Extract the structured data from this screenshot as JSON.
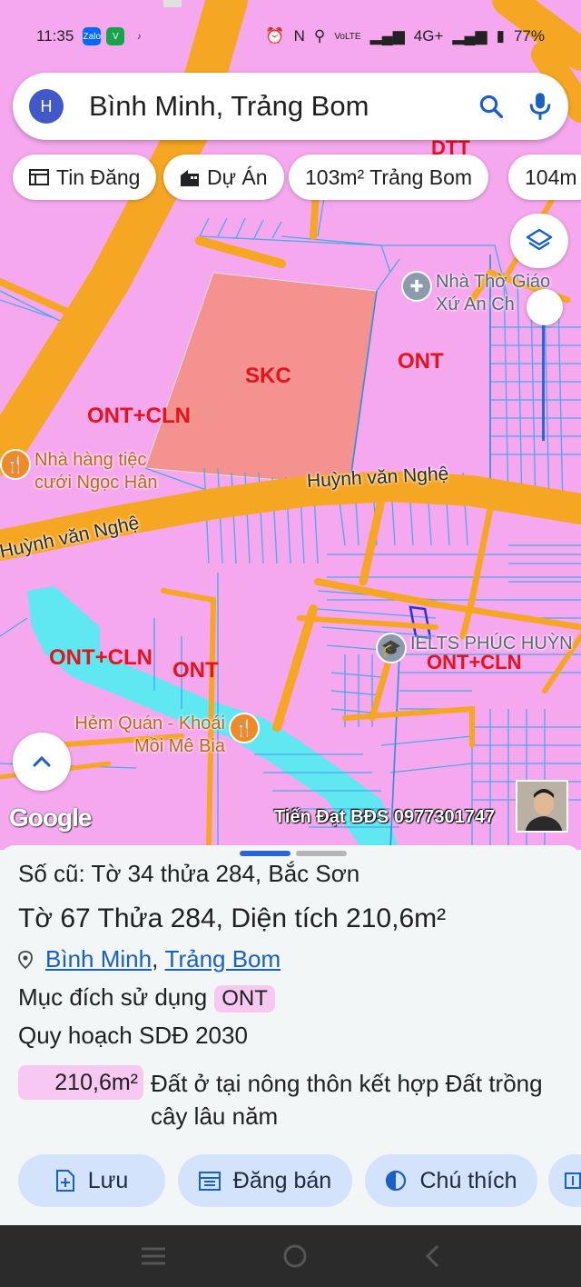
{
  "status_bar": {
    "time": "11:35",
    "apps": [
      "Zalo",
      "V",
      "TikTok"
    ],
    "network": "4G+",
    "battery": "77%",
    "volte": "VoLTE"
  },
  "search": {
    "avatar_letter": "H",
    "query": "Bình Minh, Trảng Bom"
  },
  "chips": [
    {
      "label": "Tin Đăng",
      "icon": "listing-icon"
    },
    {
      "label": "Dự Án",
      "icon": "building-icon"
    },
    {
      "label": "103m² Trảng Bom"
    },
    {
      "label": "104m"
    }
  ],
  "map": {
    "zone_labels": {
      "skc": "SKC",
      "ont_top": "ONT",
      "ont_cln_left": "ONT+CLN",
      "ont_cln_bottom_left": "ONT+CLN",
      "ont_bottom": "ONT",
      "ont_cln_right": "ONT+CLN",
      "dtt": "DTT"
    },
    "road_names": {
      "road_a": "Huỳnh văn Nghệ",
      "road_b": "Huỳnh văn Nghệ"
    },
    "pois": {
      "church": "Nhà Thờ Giáo Xứ An Ch",
      "restaurant": "Nhà hàng tiệc cưới Ngọc Hân",
      "ielts": "IELTS PHÚC HUỲN",
      "eatery": "Hẻm Quán - Khoái Mồi Mê Bia"
    },
    "google_logo": "Google",
    "watermark": "Tiến Đạt BĐS 0977301747"
  },
  "sheet": {
    "old_id": "Số cũ: Tờ 34 thửa 284, Bắc Sơn",
    "parcel": "Tờ 67 Thửa 284, Diện tích 210,6m²",
    "location": {
      "ward": "Bình Minh",
      "separator": ", ",
      "district": "Trảng Bom"
    },
    "purpose_label": "Mục đích sử dụng",
    "purpose_code": "ONT",
    "plan_label": "Quy hoạch SDĐ 2030",
    "area_value": "210,6m²",
    "area_desc": "Đất ở tại nông thôn kết hợp Đất trồng cây lâu năm"
  },
  "actions": [
    {
      "label": "Lưu",
      "icon": "add-doc-icon"
    },
    {
      "label": "Đăng bán",
      "icon": "calendar-icon"
    },
    {
      "label": "Chú thích",
      "icon": "half-circle-icon"
    }
  ],
  "colors": {
    "zone_ont": "#f6a8ee",
    "zone_skc": "#f3928e",
    "road": "#f5a623",
    "water": "#5fe8f2",
    "parcel_line": "#4aa9e8",
    "button_bg": "#d3e3fb",
    "link": "#1a5fc4"
  }
}
